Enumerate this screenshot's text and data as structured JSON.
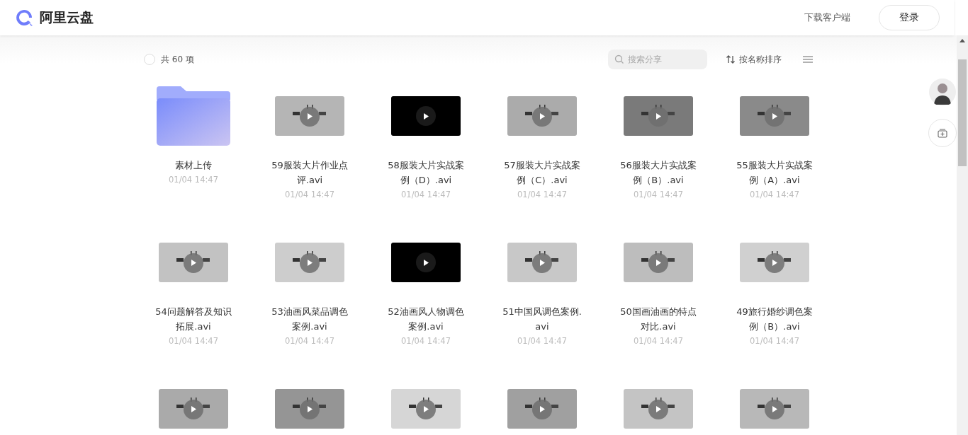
{
  "header": {
    "logo_text": "阿里云盘",
    "download_link": "下载客户端",
    "login_button": "登录"
  },
  "toolbar": {
    "select_all": {
      "checked": false
    },
    "count": "共 60 项",
    "search": {
      "placeholder": "搜索分享"
    },
    "sort": "按名称排序"
  },
  "items": [
    {
      "kind": "folder",
      "name": "素材上传",
      "date": "01/04 14:47"
    },
    {
      "kind": "video",
      "name": "59服装大片作业点评.avi",
      "date": "01/04 14:47"
    },
    {
      "kind": "video",
      "name": "58服装大片实战案例（D）.avi",
      "date": "01/04 14:47"
    },
    {
      "kind": "video",
      "name": "57服装大片实战案例（C）.avi",
      "date": "01/04 14:47"
    },
    {
      "kind": "video",
      "name": "56服装大片实战案例（B）.avi",
      "date": "01/04 14:47"
    },
    {
      "kind": "video",
      "name": "55服装大片实战案例（A）.avi",
      "date": "01/04 14:47"
    },
    {
      "kind": "video",
      "name": "54问题解答及知识拓展.avi",
      "date": "01/04 14:47"
    },
    {
      "kind": "video",
      "name": "53油画风菜品调色案例.avi",
      "date": "01/04 14:47"
    },
    {
      "kind": "video",
      "name": "52油画风人物调色案例.avi",
      "date": "01/04 14:47"
    },
    {
      "kind": "video",
      "name": "51中国风调色案例.avi",
      "date": "01/04 14:47"
    },
    {
      "kind": "video",
      "name": "50国画油画的特点对比.avi",
      "date": "01/04 14:47"
    },
    {
      "kind": "video",
      "name": "49旅行婚纱调色案例（B）.avi",
      "date": "01/04 14:47"
    },
    {
      "kind": "video"
    },
    {
      "kind": "video"
    },
    {
      "kind": "video"
    },
    {
      "kind": "video"
    },
    {
      "kind": "video"
    },
    {
      "kind": "video"
    }
  ]
}
